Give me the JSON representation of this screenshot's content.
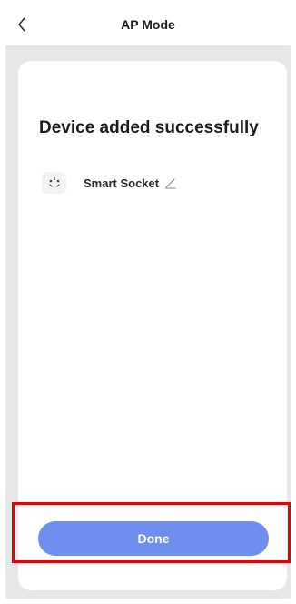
{
  "header": {
    "title": "AP Mode",
    "back_icon": "chevron-left-icon"
  },
  "main": {
    "headline": "Device added successfully",
    "device": {
      "name": "Smart Socket",
      "icon": "smart-socket-icon",
      "edit_icon": "pencil-icon"
    }
  },
  "footer": {
    "done_label": "Done"
  },
  "colors": {
    "accent": "#6e8ff0",
    "background": "#e7e7e9",
    "highlight": "#e60000"
  }
}
